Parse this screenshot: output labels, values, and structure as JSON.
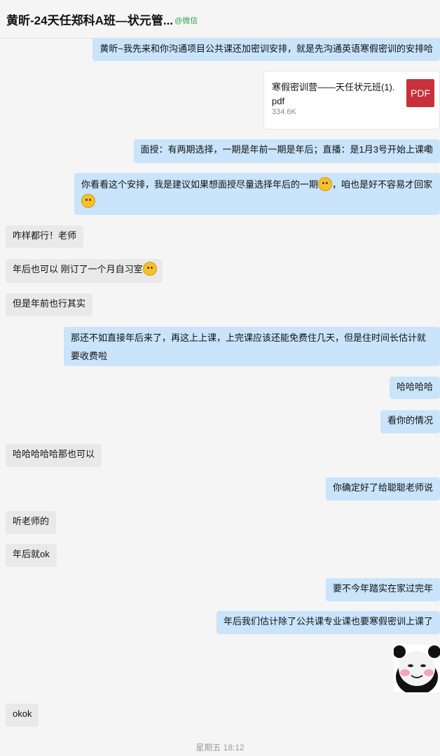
{
  "header": {
    "title": "黄昕-24天任郑科A班—状元管...",
    "source": "@微信"
  },
  "messages": {
    "m1": "黄昕~我先来和你沟通项目公共课还加密训安排，就是先沟通英语寒假密训的安排哈",
    "file": {
      "name": "寒假密训营——天任状元班(1).pdf",
      "size": "334.6K",
      "icon_label": "PDF"
    },
    "m2": "面授：有两期选择，一期是年前一期是年后；直播：是1月3号开始上课嘞",
    "m3a": "你看看这个安排，我是建议如果想面授尽量选择年后的一期",
    "m3b": "，咱也是好不容易才回家",
    "m4": "咋样都行！老师",
    "m5": "年后也可以 刚订了一个月自习室",
    "m6": "但是年前也行其实",
    "m7": "那还不如直接年后来了，再这上上课，上完课应该还能免费住几天，但是住时间长估计就要收费啦",
    "m8": "哈哈哈哈",
    "m9": "看你的情况",
    "m10": "哈哈哈哈哈那也可以",
    "m11": "你确定好了给聪聪老师说",
    "m12": "听老师的",
    "m13": "年后就ok",
    "m14": "要不今年踏实在家过完年",
    "m15": "年后我们估计除了公共课专业课也要寒假密训上课了",
    "m16": "okok"
  },
  "timestamp": "星期五 18:12",
  "colors": {
    "sent_bubble": "#c9e4fb",
    "received_bubble": "#e9e9e9",
    "pdf_red": "#c8313a",
    "source_green": "#3aa14c"
  },
  "icons": [
    "emoji-grimace-icon",
    "emoji-laugh-cry-icon",
    "pdf-file-icon",
    "panda-sticker"
  ]
}
